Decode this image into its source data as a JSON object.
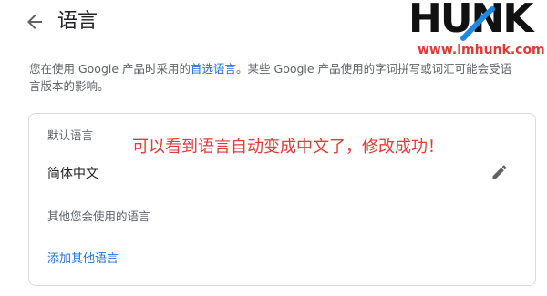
{
  "header": {
    "title": "语言"
  },
  "watermark": {
    "logo_text": "HUNK",
    "url": "www.imhunk.com"
  },
  "description": {
    "prefix": "您在使用 Google 产品时采用的",
    "link": "首选语言",
    "suffix": "。某些 Google 产品使用的字词拼写或词汇可能会受语言版本的影响。"
  },
  "card": {
    "default_label": "默认语言",
    "current_language": "简体中文",
    "other_label": "其他您会使用的语言",
    "add_link": "添加其他语言"
  },
  "annotation": "可以看到语言自动变成中文了，修改成功！",
  "colors": {
    "link": "#1a73e8",
    "annotation": "#e53935",
    "logo_accent": "#1e88e5"
  }
}
